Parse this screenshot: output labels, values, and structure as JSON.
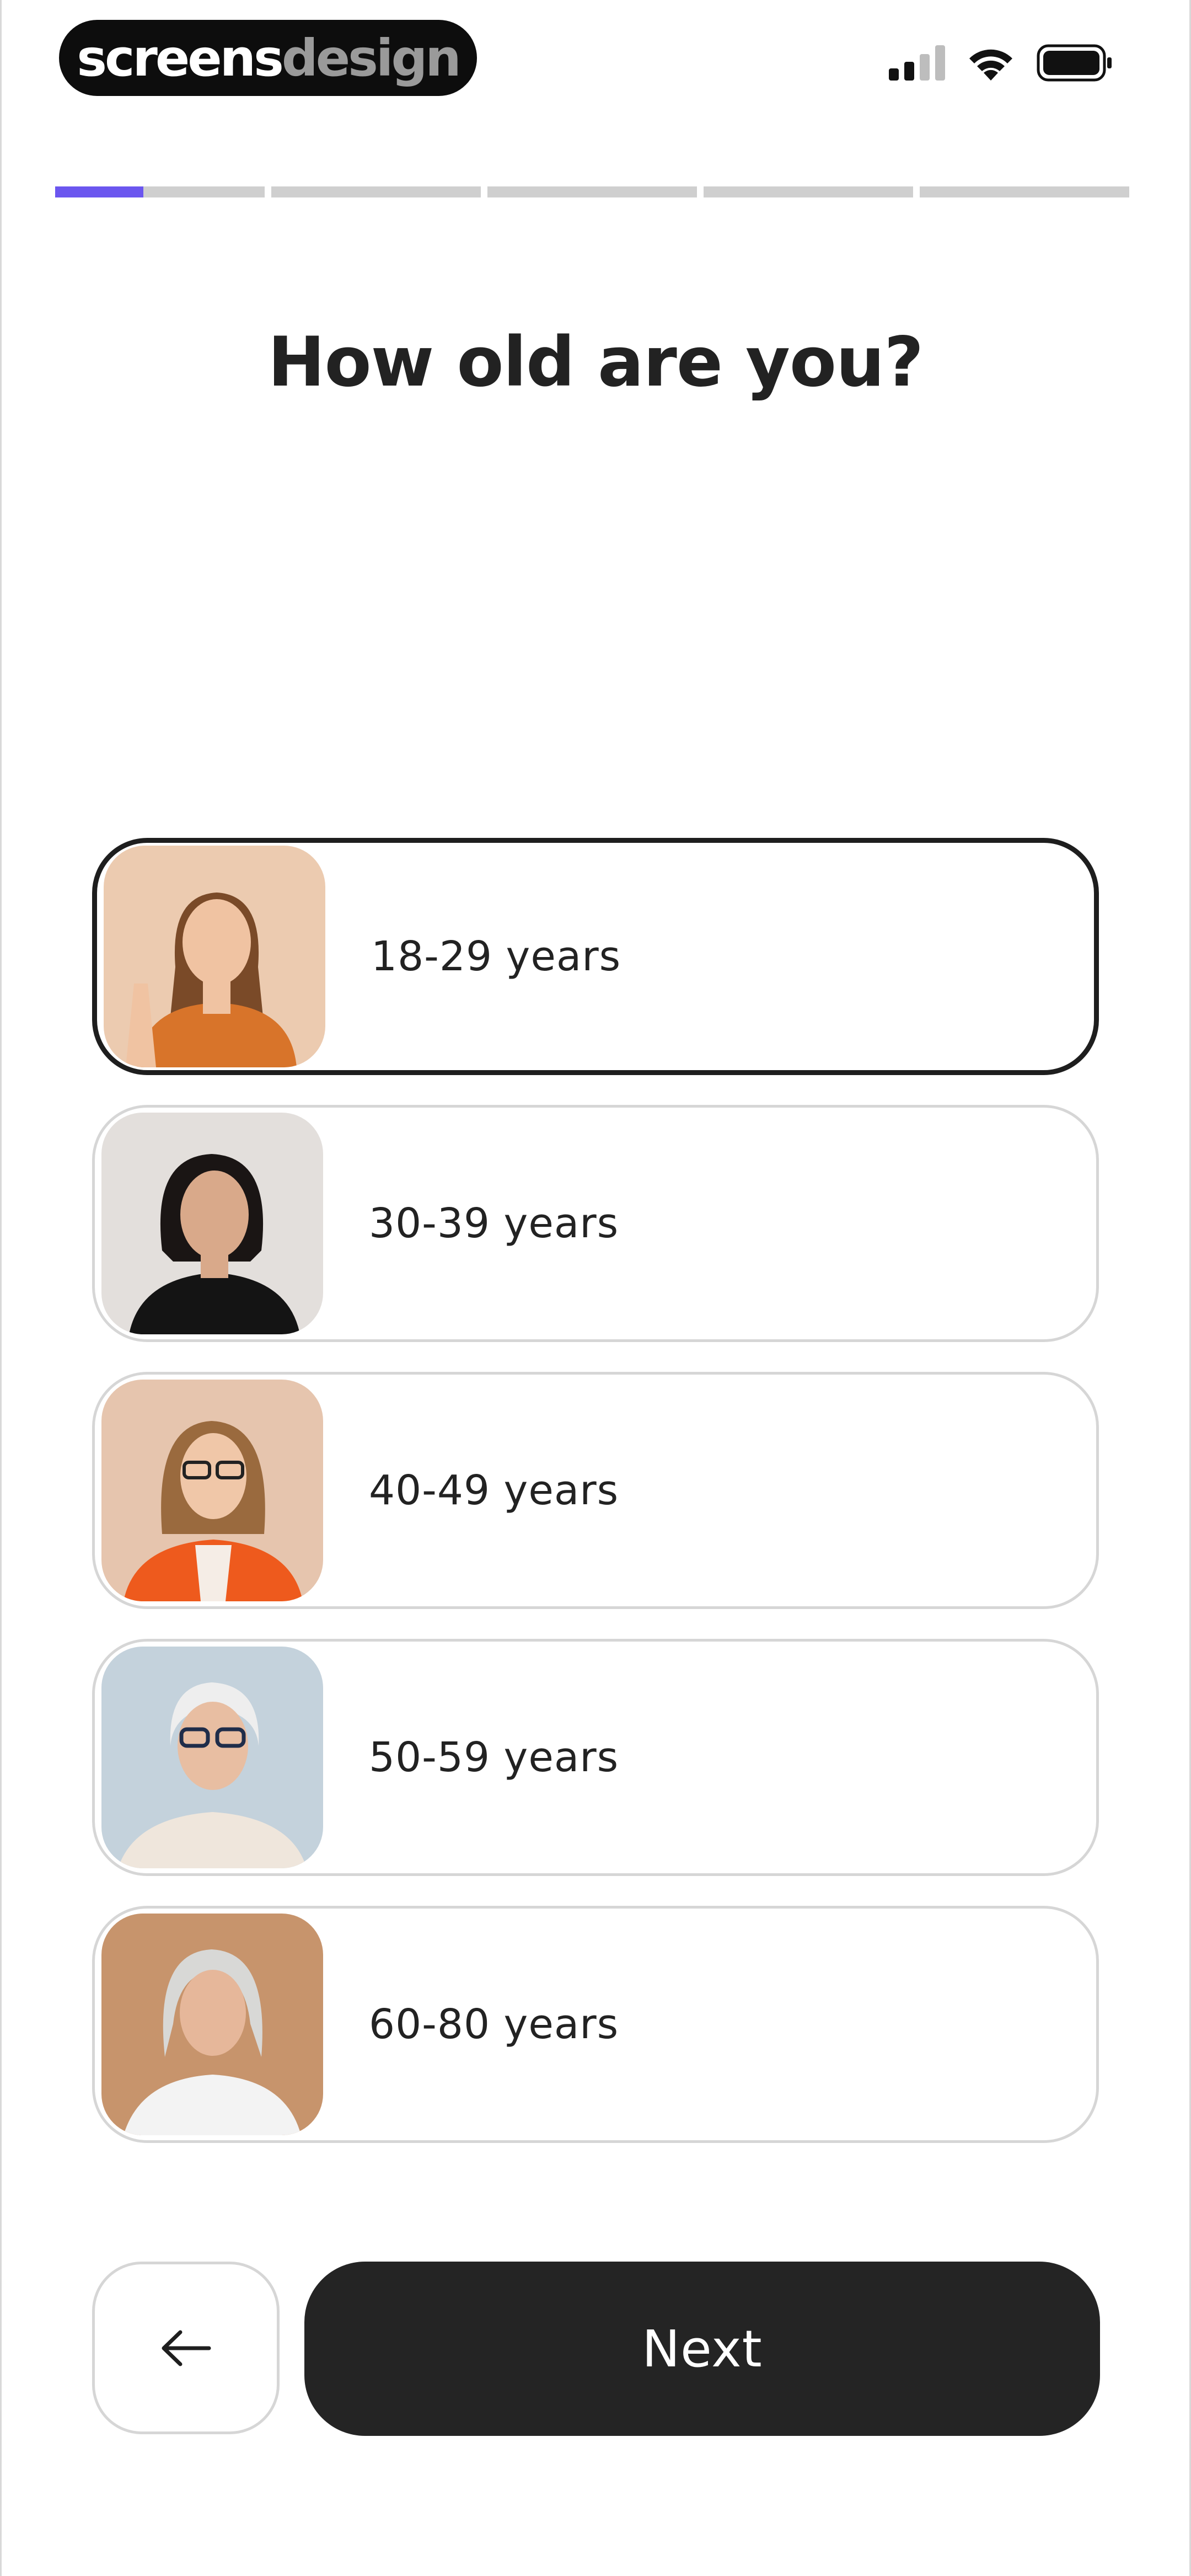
{
  "brand": {
    "word1": "screens",
    "word2": "design"
  },
  "status": {
    "signal_icon": "cellular-signal-icon",
    "wifi_icon": "wifi-icon",
    "battery_icon": "battery-icon"
  },
  "progress": {
    "total_steps": 6,
    "current_step": 1,
    "current_step_fill": 0.42,
    "accent_color": "#6b56ef"
  },
  "question": {
    "title": "How old are you?"
  },
  "options": [
    {
      "label": "18-29 years",
      "selected": true
    },
    {
      "label": "30-39 years",
      "selected": false
    },
    {
      "label": "40-49 years",
      "selected": false
    },
    {
      "label": "50-59 years",
      "selected": false
    },
    {
      "label": "60-80 years",
      "selected": false
    }
  ],
  "nav": {
    "back_icon": "arrow-left-icon",
    "next_label": "Next"
  }
}
